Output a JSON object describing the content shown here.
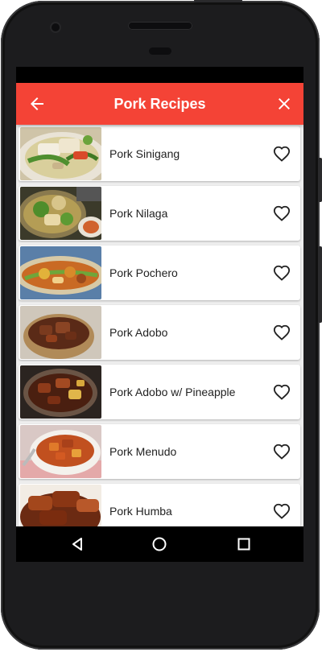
{
  "app": {
    "title": "Pork Recipes"
  },
  "icons": {
    "back": "arrow-left-icon",
    "close": "close-icon",
    "favorite": "heart-outline-icon"
  },
  "colors": {
    "appbar": "#f44336",
    "list_bg": "#eeeeee"
  },
  "recipes": [
    {
      "name": "Pork Sinigang"
    },
    {
      "name": "Pork Nilaga"
    },
    {
      "name": "Pork Pochero"
    },
    {
      "name": "Pork Adobo"
    },
    {
      "name": "Pork Adobo w/ Pineapple"
    },
    {
      "name": "Pork Menudo"
    },
    {
      "name": "Pork Humba"
    }
  ]
}
